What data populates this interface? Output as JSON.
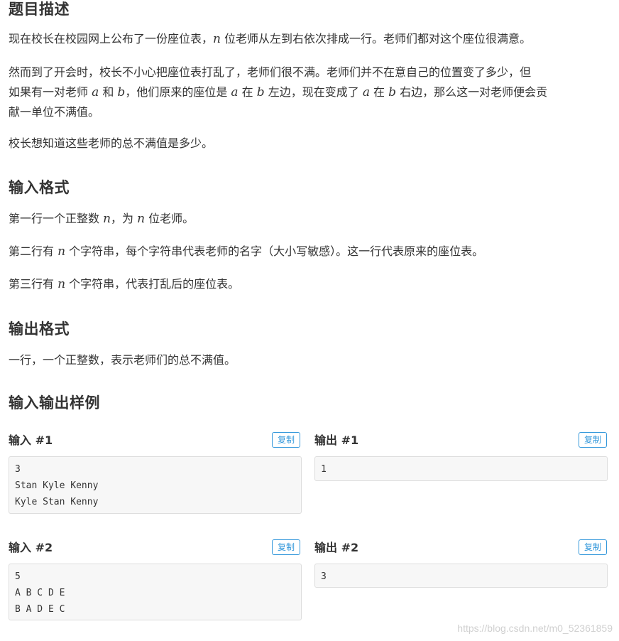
{
  "sections": {
    "description": {
      "heading": "题目描述",
      "p1_a": "现在校长在校园网上公布了一份座位表，",
      "p1_var": "n",
      "p1_b": " 位老师从左到右依次排成一行。老师们都对这个座位很满意。",
      "p2_line1_a": "然而到了开会时，校长不小心把座位表打乱了，老师们很不满。老师们并不在意自己的位置变了多少，但",
      "p2_line2_a": "如果有一对老师 ",
      "p2_var_a1": "a",
      "p2_line2_b": " 和 ",
      "p2_var_b1": "b",
      "p2_line2_c": "，他们原来的座位是 ",
      "p2_var_a2": "a",
      "p2_line2_d": " 在 ",
      "p2_var_b2": "b",
      "p2_line2_e": " 左边，现在变成了 ",
      "p2_var_a3": "a",
      "p2_line2_f": " 在 ",
      "p2_var_b3": "b",
      "p2_line2_g": " 右边，那么这一对老师便会贡",
      "p2_line3": "献一单位不满值。",
      "p3": "校长想知道这些老师的总不满值是多少。"
    },
    "input_format": {
      "heading": "输入格式",
      "l1_a": "第一行一个正整数 ",
      "l1_var1": "n",
      "l1_b": "，为 ",
      "l1_var2": "n",
      "l1_c": " 位老师。",
      "l2_a": "第二行有 ",
      "l2_var": "n",
      "l2_b": " 个字符串，每个字符串代表老师的名字（大小写敏感）。这一行代表原来的座位表。",
      "l3_a": "第三行有 ",
      "l3_var": "n",
      "l3_b": " 个字符串，代表打乱后的座位表。"
    },
    "output_format": {
      "heading": "输出格式",
      "l1": "一行，一个正整数，表示老师们的总不满值。"
    },
    "samples": {
      "heading": "输入输出样例",
      "copy_label": "复制",
      "items": [
        {
          "input_title": "输入 #1",
          "input": "3\nStan Kyle Kenny\nKyle Stan Kenny",
          "output_title": "输出 #1",
          "output": "1"
        },
        {
          "input_title": "输入 #2",
          "input": "5\nA B C D E\nB A D E C",
          "output_title": "输出 #2",
          "output": "3"
        }
      ]
    }
  },
  "watermark": "https://blog.csdn.net/m0_52361859"
}
